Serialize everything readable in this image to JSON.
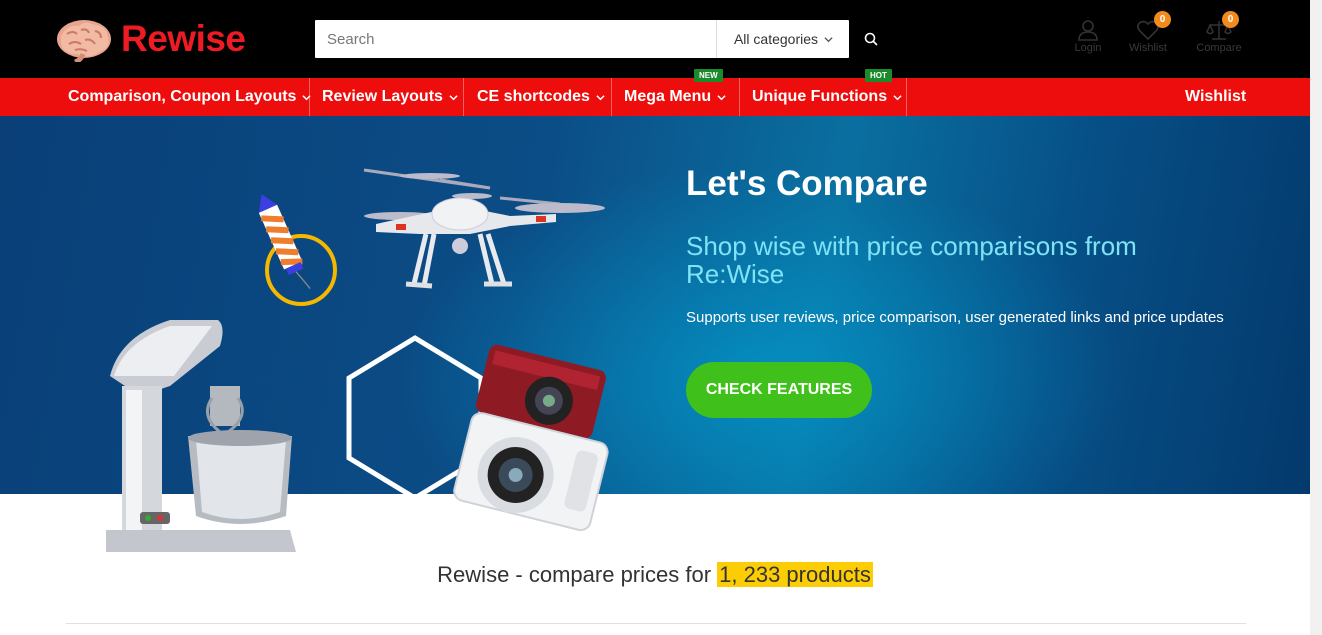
{
  "header": {
    "brand": "Rewise",
    "search": {
      "placeholder": "Search",
      "category": "All categories"
    },
    "icons": [
      {
        "name": "login",
        "label": "Login"
      },
      {
        "name": "wishlist",
        "label": "Wishlist",
        "badge": "0"
      },
      {
        "name": "compare",
        "label": "Compare",
        "badge": "0"
      }
    ]
  },
  "nav": {
    "items": [
      {
        "label": "Comparison, Coupon Layouts"
      },
      {
        "label": "Review Layouts"
      },
      {
        "label": "CE shortcodes"
      },
      {
        "label": "Mega Menu",
        "tag": "NEW"
      },
      {
        "label": "Unique Functions",
        "tag": "HOT"
      }
    ],
    "right": "Wishlist"
  },
  "hero": {
    "title": "Let's Compare",
    "subtitle": "Shop wise with price comparisons from Re:Wise",
    "description": "Supports user reviews, price comparison, user generated links and price updates",
    "cta": "CHECK FEATURES"
  },
  "summary": {
    "prefix": "Rewise - compare prices for ",
    "count": "1, 233 products"
  },
  "colors": {
    "brand_red": "#ee1b24",
    "nav_red": "#ee0d0d",
    "cta_green": "#3fc01a",
    "badge_orange": "#f28a1d",
    "highlight_yellow": "#fccd05",
    "tag_green": "#1b8a2a"
  }
}
